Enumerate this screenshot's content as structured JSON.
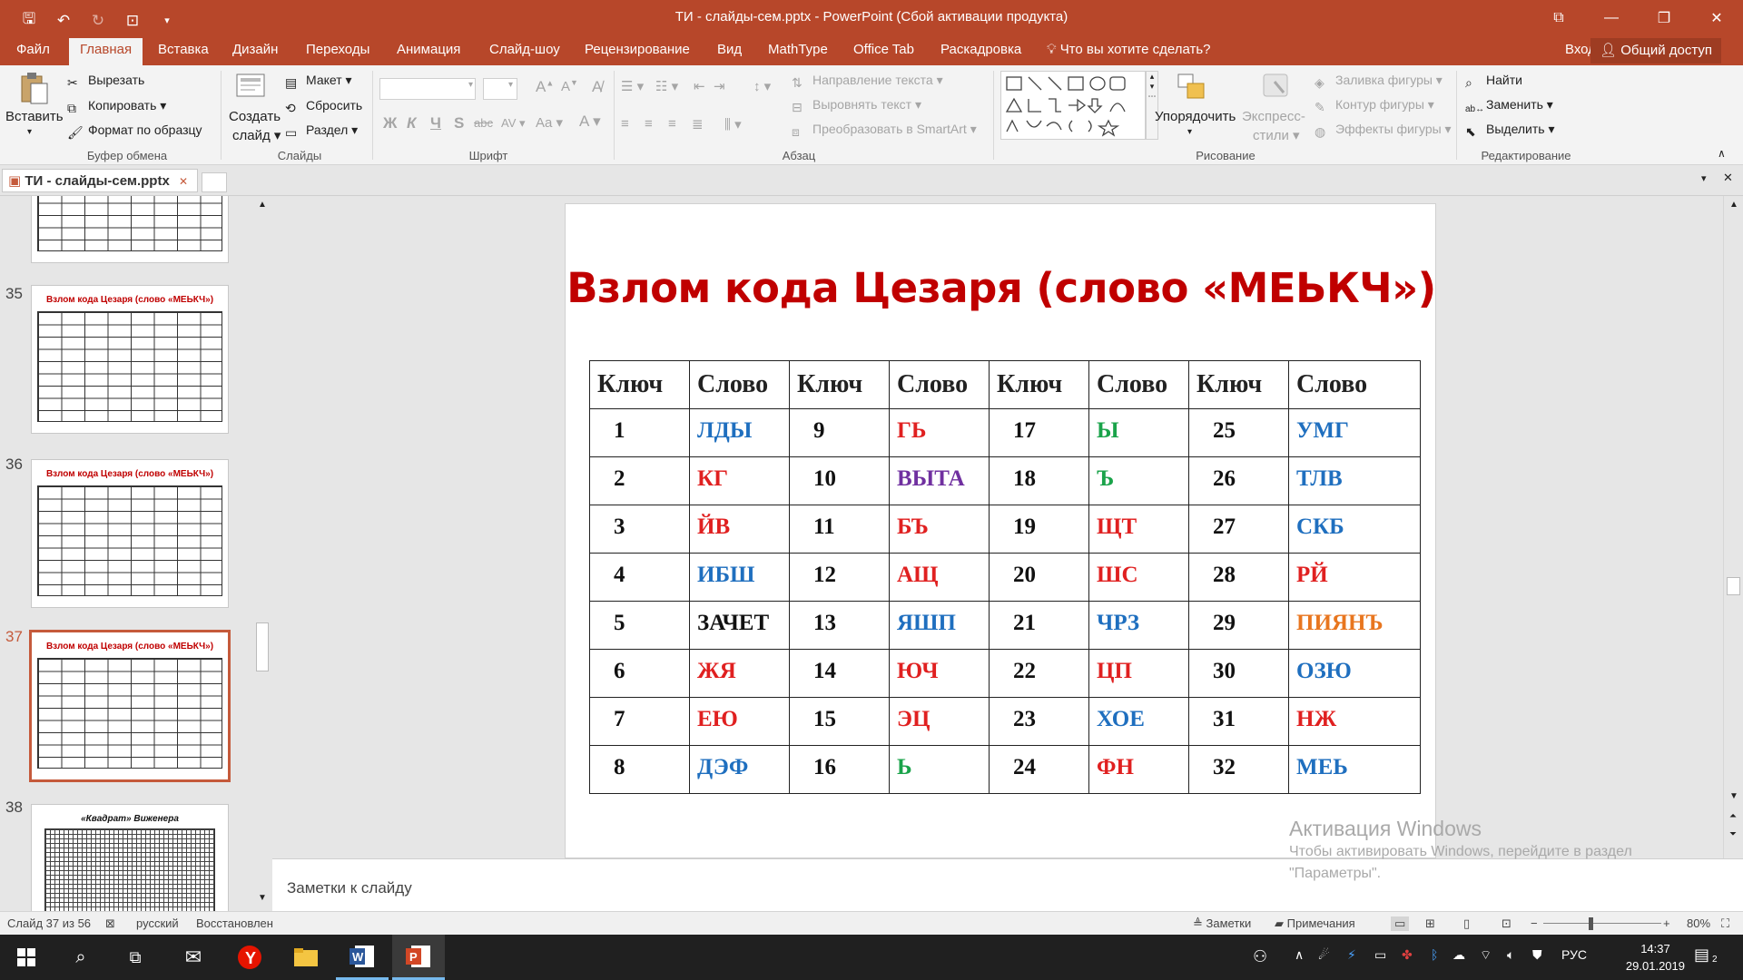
{
  "window": {
    "title": "ТИ - слайды-сем.pptx - PowerPoint (Сбой активации продукта)"
  },
  "tabs": {
    "file": "Файл",
    "items": [
      "Главная",
      "Вставка",
      "Дизайн",
      "Переходы",
      "Анимация",
      "Слайд-шоу",
      "Рецензирование",
      "Вид",
      "MathType",
      "Office Tab",
      "Раскадровка"
    ],
    "tell_me": "Что вы хотите сделать?",
    "signin": "Вход",
    "share": "Общий доступ"
  },
  "ribbon": {
    "clipboard": {
      "label": "Буфер обмена",
      "paste": "Вставить",
      "cut": "Вырезать",
      "copy": "Копировать",
      "format_painter": "Формат по образцу"
    },
    "slides": {
      "label": "Слайды",
      "new_slide_1": "Создать",
      "new_slide_2": "слайд",
      "layout": "Макет",
      "reset": "Сбросить",
      "section": "Раздел"
    },
    "font": {
      "label": "Шрифт",
      "bold": "Ж",
      "italic": "К",
      "underline": "Ч",
      "shadow": "S",
      "strike": "abc",
      "spacing": "AV",
      "case": "Aa",
      "color": "A"
    },
    "paragraph": {
      "label": "Абзац",
      "text_direction": "Направление текста",
      "align_text": "Выровнять текст",
      "smartart": "Преобразовать в SmartArt"
    },
    "drawing": {
      "label": "Рисование",
      "arrange": "Упорядочить",
      "quick_styles_1": "Экспресс-",
      "quick_styles_2": "стили",
      "fill": "Заливка фигуры",
      "outline": "Контур фигуры",
      "effects": "Эффекты фигуры"
    },
    "editing": {
      "label": "Редактирование",
      "find": "Найти",
      "replace": "Заменить",
      "select": "Выделить"
    }
  },
  "doc_tab": {
    "name": "ТИ - слайды-сем.pptx"
  },
  "thumbnails": [
    {
      "num": "35",
      "title": "Взлом кода Цезаря (слово «МЕЬКЧ»)"
    },
    {
      "num": "36",
      "title": "Взлом кода Цезаря (слово «МЕЬКЧ»)"
    },
    {
      "num": "37",
      "title": "Взлом кода Цезаря (слово «МЕЬКЧ»)"
    },
    {
      "num": "38",
      "title": "«Квадрат» Виженера"
    }
  ],
  "slide": {
    "title": "Взлом кода Цезаря (слово «МЕЬКЧ»)",
    "headers": [
      "Ключ",
      "Слово",
      "Ключ",
      "Слово",
      "Ключ",
      "Слово",
      "Ключ",
      "Слово"
    ],
    "rows": [
      [
        {
          "k": "1",
          "w": "ЛДЫ",
          "c": "#1f6fbf"
        },
        {
          "k": "9",
          "w": "ГЬ",
          "c": "#e02020"
        },
        {
          "k": "17",
          "w": "Ы",
          "c": "#1aa34a"
        },
        {
          "k": "25",
          "w": "УМГ",
          "c": "#1f6fbf"
        }
      ],
      [
        {
          "k": "2",
          "w": "КГ",
          "c": "#e02020"
        },
        {
          "k": "10",
          "w": "ВЫТА",
          "c": "#7030a0"
        },
        {
          "k": "18",
          "w": "Ъ",
          "c": "#1aa34a"
        },
        {
          "k": "26",
          "w": "ТЛВ",
          "c": "#1f6fbf"
        }
      ],
      [
        {
          "k": "3",
          "w": "ЙВ",
          "c": "#e02020"
        },
        {
          "k": "11",
          "w": "БЪ",
          "c": "#e02020"
        },
        {
          "k": "19",
          "w": "ЩТ",
          "c": "#e02020"
        },
        {
          "k": "27",
          "w": "СКБ",
          "c": "#1f6fbf"
        }
      ],
      [
        {
          "k": "4",
          "w": "ИБШ",
          "c": "#1f6fbf"
        },
        {
          "k": "12",
          "w": "АЩ",
          "c": "#e02020"
        },
        {
          "k": "20",
          "w": "ШС",
          "c": "#e02020"
        },
        {
          "k": "28",
          "w": "РЙ",
          "c": "#e02020"
        }
      ],
      [
        {
          "k": "5",
          "w": "ЗАЧЕТ",
          "c": "#111111"
        },
        {
          "k": "13",
          "w": "ЯШП",
          "c": "#1f6fbf"
        },
        {
          "k": "21",
          "w": "ЧРЗ",
          "c": "#1f6fbf"
        },
        {
          "k": "29",
          "w": "ПИЯНЪ",
          "c": "#e8761f"
        }
      ],
      [
        {
          "k": "6",
          "w": "ЖЯ",
          "c": "#e02020"
        },
        {
          "k": "14",
          "w": "ЮЧ",
          "c": "#e02020"
        },
        {
          "k": "22",
          "w": "ЦП",
          "c": "#e02020"
        },
        {
          "k": "30",
          "w": "ОЗЮ",
          "c": "#1f6fbf"
        }
      ],
      [
        {
          "k": "7",
          "w": "ЕЮ",
          "c": "#e02020"
        },
        {
          "k": "15",
          "w": "ЭЦ",
          "c": "#e02020"
        },
        {
          "k": "23",
          "w": "ХОЕ",
          "c": "#1f6fbf"
        },
        {
          "k": "31",
          "w": "НЖ",
          "c": "#e02020"
        }
      ],
      [
        {
          "k": "8",
          "w": "ДЭФ",
          "c": "#1f6fbf"
        },
        {
          "k": "16",
          "w": "Ь",
          "c": "#1aa34a"
        },
        {
          "k": "24",
          "w": "ФН",
          "c": "#e02020"
        },
        {
          "k": "32",
          "w": "МЕЬ",
          "c": "#1f6fbf"
        }
      ]
    ]
  },
  "notes": {
    "placeholder": "Заметки к слайду"
  },
  "activation": {
    "heading": "Активация Windows",
    "line1": "Чтобы активировать Windows, перейдите в раздел",
    "line2": "\"Параметры\"."
  },
  "statusbar": {
    "slide_of": "Слайд 37 из 56",
    "language": "русский",
    "recovered": "Восстановлен",
    "notes": "Заметки",
    "comments": "Примечания",
    "zoom": "80%"
  },
  "taskbar": {
    "lang": "РУС",
    "time": "14:37",
    "date": "29.01.2019",
    "notif": "2"
  }
}
